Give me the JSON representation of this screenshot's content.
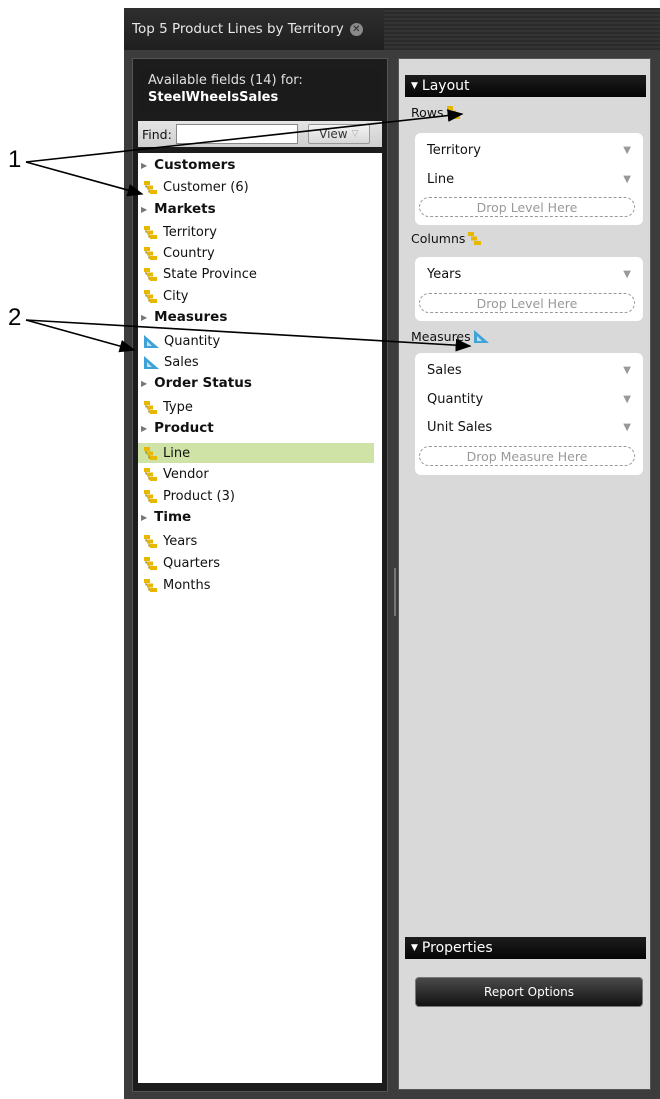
{
  "tab": {
    "title": "Top 5 Product Lines by Territory",
    "close_glyph": "✕"
  },
  "callouts": {
    "one": "1",
    "two": "2"
  },
  "available": {
    "header": "Available fields (14) for:",
    "cube": "SteelWheelsSales"
  },
  "find": {
    "label": "Find:",
    "value": "",
    "view_label": "View",
    "view_caret": "▽"
  },
  "fields": {
    "g_customers": "Customers",
    "customer": "Customer (6)",
    "g_markets": "Markets",
    "territory": "Territory",
    "country": "Country",
    "state_province": "State Province",
    "city": "City",
    "g_measures": "Measures",
    "quantity": "Quantity",
    "sales": "Sales",
    "g_order_status": "Order Status",
    "type": "Type",
    "g_product": "Product",
    "line": "Line",
    "vendor": "Vendor",
    "product": "Product (3)",
    "g_time": "Time",
    "years": "Years",
    "quarters": "Quarters",
    "months": "Months"
  },
  "layout": {
    "title": "Layout",
    "rows_label": "Rows",
    "rows": [
      "Territory",
      "Line"
    ],
    "rows_drop": "Drop Level Here",
    "columns_label": "Columns",
    "columns": [
      "Years"
    ],
    "columns_drop": "Drop Level Here",
    "measures_label": "Measures",
    "measures": [
      "Sales",
      "Quantity",
      "Unit Sales"
    ],
    "measures_drop": "Drop Measure Here"
  },
  "properties": {
    "title": "Properties",
    "report_options": "Report Options"
  },
  "icons": {
    "hierarchy": "hierarchy-icon",
    "measure": "measure-icon",
    "collapse": "triangle-icon",
    "dropdown": "chevron-down-icon"
  },
  "colors": {
    "selected_row": "#cfe3a6",
    "hierarchy_icon": "#e8b800",
    "measure_icon": "#3fa3d8",
    "panel_bg": "#d9d9d9"
  }
}
